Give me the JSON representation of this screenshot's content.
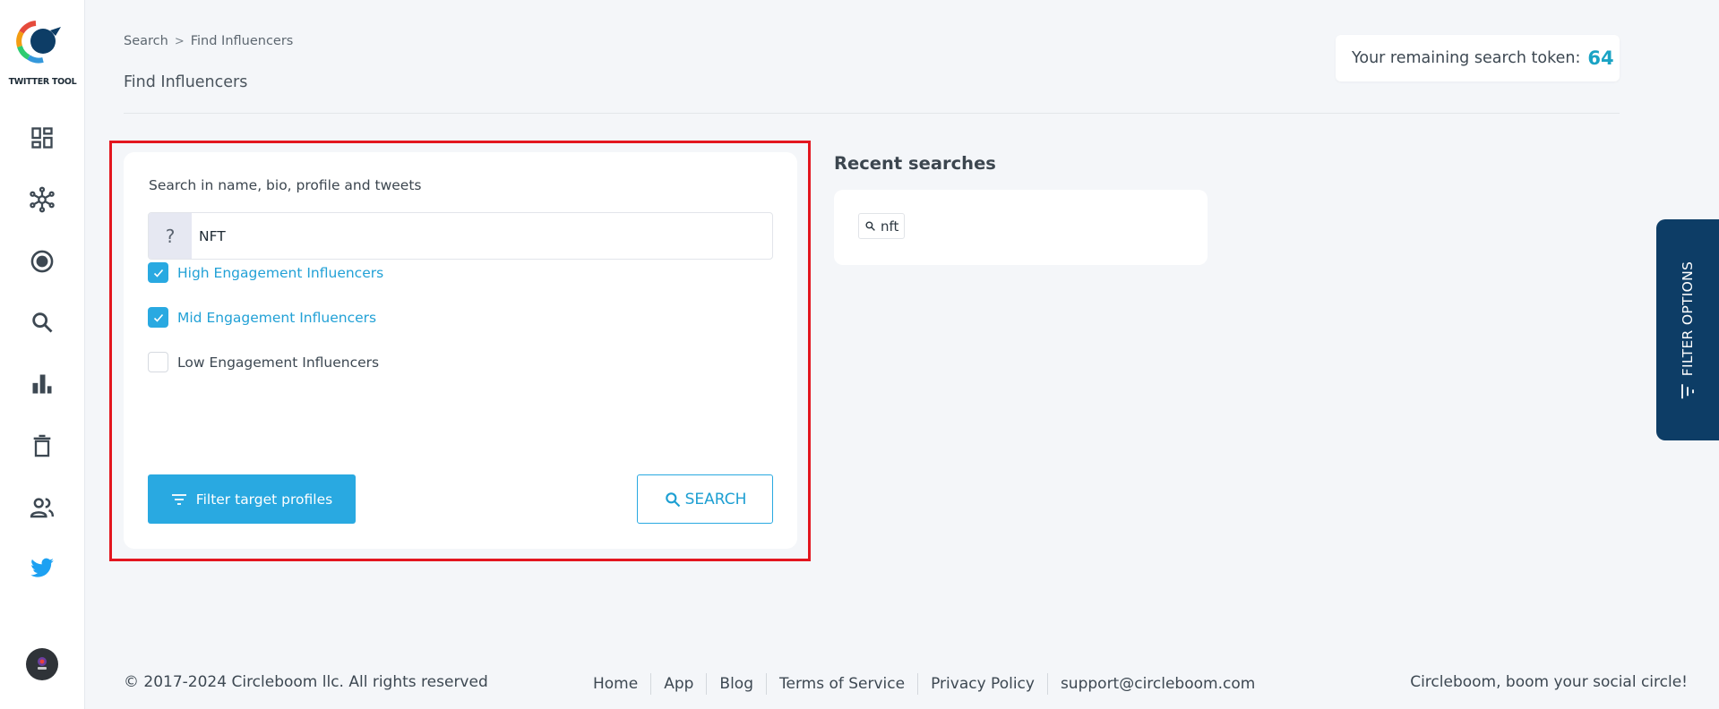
{
  "sidebar": {
    "logo_text": "TWITTER TOOL",
    "items": [
      {
        "icon": "dashboard-icon"
      },
      {
        "icon": "network-icon"
      },
      {
        "icon": "target-icon"
      },
      {
        "icon": "search-icon"
      },
      {
        "icon": "bar-chart-icon"
      },
      {
        "icon": "trash-icon"
      },
      {
        "icon": "users-icon"
      },
      {
        "icon": "twitter-icon"
      }
    ]
  },
  "header": {
    "breadcrumb": [
      "Search",
      "Find Influencers"
    ],
    "page_title": "Find Influencers",
    "token_label": "Your remaining search token:",
    "token_value": "64"
  },
  "search_card": {
    "label": "Search in name, bio, profile and tweets",
    "input_prefix": "?",
    "input_value": "NFT",
    "checkboxes": [
      {
        "label": "High Engagement Influencers",
        "checked": true
      },
      {
        "label": "Mid Engagement Influencers",
        "checked": true
      },
      {
        "label": "Low Engagement Influencers",
        "checked": false
      }
    ],
    "filter_button": "Filter target profiles",
    "search_button": "SEARCH"
  },
  "recent": {
    "title": "Recent searches",
    "items": [
      "nft"
    ]
  },
  "filter_tab": {
    "label": "FILTER OPTIONS"
  },
  "footer": {
    "copyright": "© 2017-2024 Circleboom llc. All rights reserved",
    "links": [
      "Home",
      "App",
      "Blog",
      "Terms of Service",
      "Privacy Policy",
      "support@circleboom.com"
    ],
    "slogan": "Circleboom, boom your social circle!"
  },
  "colors": {
    "accent": "#29a9e1",
    "navy": "#0d3d66",
    "highlight": "#e3161f",
    "token": "#1aa3c4"
  }
}
